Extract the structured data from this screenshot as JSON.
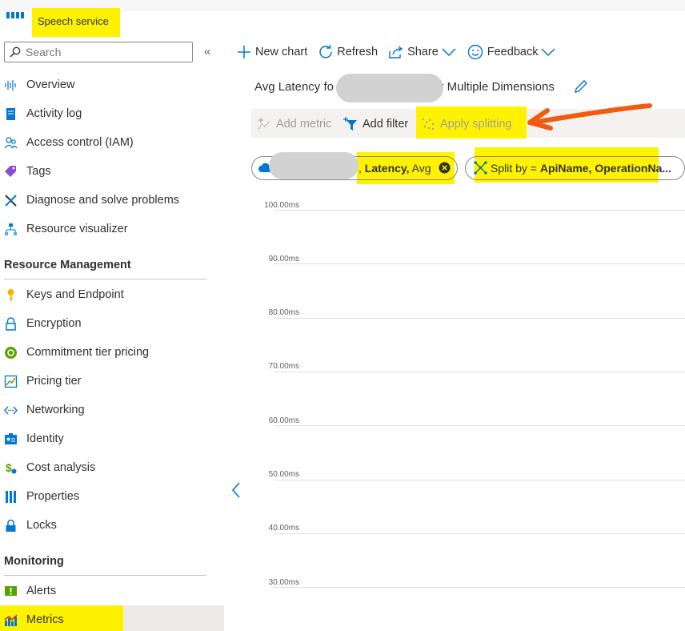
{
  "header": {
    "title": "Speech service"
  },
  "search": {
    "placeholder": "Search",
    "value": "Search"
  },
  "sidebar": {
    "collapse_glyph": "«",
    "items": [
      {
        "label": "Overview",
        "icon": "overview-icon"
      },
      {
        "label": "Activity log",
        "icon": "activity-log-icon"
      },
      {
        "label": "Access control (IAM)",
        "icon": "access-control-icon"
      },
      {
        "label": "Tags",
        "icon": "tag-icon"
      },
      {
        "label": "Diagnose and solve problems",
        "icon": "diagnose-icon"
      },
      {
        "label": "Resource visualizer",
        "icon": "resource-visualizer-icon"
      }
    ],
    "sections": [
      {
        "title": "Resource Management",
        "items": [
          {
            "label": "Keys and Endpoint",
            "icon": "key-icon"
          },
          {
            "label": "Encryption",
            "icon": "lock-icon"
          },
          {
            "label": "Commitment tier pricing",
            "icon": "commitment-icon"
          },
          {
            "label": "Pricing tier",
            "icon": "pricing-tier-icon"
          },
          {
            "label": "Networking",
            "icon": "networking-icon"
          },
          {
            "label": "Identity",
            "icon": "identity-icon"
          },
          {
            "label": "Cost analysis",
            "icon": "cost-analysis-icon"
          },
          {
            "label": "Properties",
            "icon": "properties-icon"
          },
          {
            "label": "Locks",
            "icon": "locks-icon"
          }
        ]
      },
      {
        "title": "Monitoring",
        "items": [
          {
            "label": "Alerts",
            "icon": "alerts-icon"
          },
          {
            "label": "Metrics",
            "icon": "metrics-icon",
            "selected": true
          }
        ]
      }
    ]
  },
  "toolbar": {
    "new_chart": "New chart",
    "refresh": "Refresh",
    "share": "Share",
    "feedback": "Feedback"
  },
  "chart": {
    "title_start": "Avg Latency fo",
    "title_end": "y Multiple Dimensions",
    "add_metric": "Add metric",
    "add_filter": "Add filter",
    "apply_splitting": "Apply splitting",
    "metric_pill": {
      "prefix": ",",
      "metric": "Latency,",
      "aggregation": "Avg"
    },
    "split_pill": {
      "prefix": "Split by =",
      "dimensions": "ApiName, OperationNa..."
    },
    "y_ticks": [
      "100.00ms",
      "90.00ms",
      "80.00ms",
      "70.00ms",
      "60.00ms",
      "50.00ms",
      "40.00ms",
      "30.00ms"
    ]
  },
  "colors": {
    "accent": "#0078d4",
    "highlight": "#fff200",
    "annotation_arrow": "#f25b0f",
    "selected_bg": "#edebe9"
  }
}
